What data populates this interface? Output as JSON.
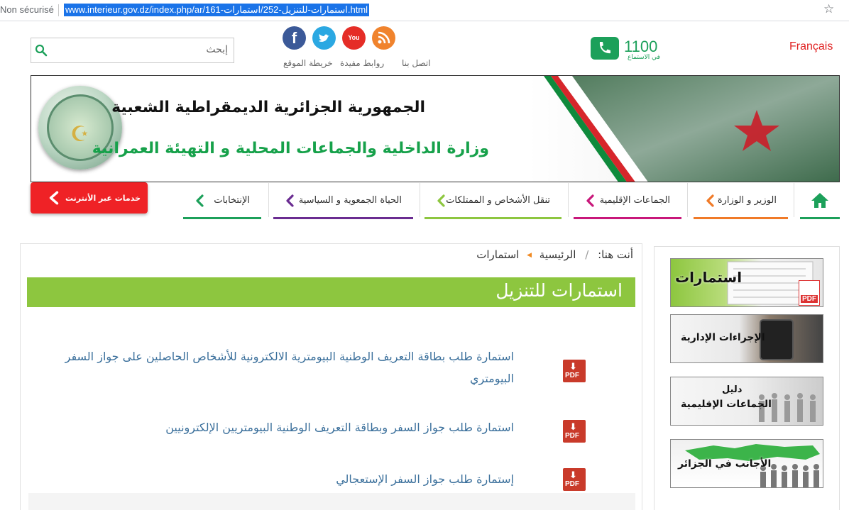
{
  "browser": {
    "insecure_label": "Non sécurisé",
    "url": "www.interieur.gov.dz/index.php/ar/161-استمارات-للتنزيل-252/استمارات.html",
    "star_icon": "star-icon"
  },
  "header": {
    "search_placeholder": "إبحث",
    "social_icons": [
      "facebook-icon",
      "twitter-icon",
      "youtube-icon",
      "rss-icon"
    ],
    "facebook_letter": "f",
    "youtube_text": "You Tube",
    "links": [
      "اتصل بنا",
      "روابط مفيدة",
      "خريطة الموقع"
    ],
    "hotline_number": "1100",
    "hotline_caption": "في الاستماع",
    "language": "Français"
  },
  "banner": {
    "title_line1": "الجمهورية الجزائرية الديمقراطية الشعبية",
    "title_line2": "وزارة الداخلية والجماعات المحلية و التهيئة العمرانية"
  },
  "nav": {
    "home_icon": "home-icon",
    "items": [
      {
        "label": "الوزير و الوزارة",
        "color": "#f07a28"
      },
      {
        "label": "الجماعات الإقليمية",
        "color": "#c8177a"
      },
      {
        "label": "تنقل الأشخاص و الممتلكات",
        "color": "#8dc63f"
      },
      {
        "label": "الحياة الجمعوية و السياسية",
        "color": "#6a2c91"
      },
      {
        "label": "الإنتخابات",
        "color": "#1ca05a"
      }
    ],
    "home_color": "#1ca05a",
    "online_services": "خدمات عبر الأنترنت",
    "online_color": "#ef2226"
  },
  "breadcrumb": {
    "prefix": "أنت هنا:",
    "home": "الرئيسية",
    "current": "استمارات"
  },
  "main": {
    "title": "استمارات للتنزيل",
    "documents": [
      {
        "title": "استمارة طلب بطاقة التعريف الوطنية البيومترية الالكترونية للأشخاص الحاصلين على جواز السفر البيومتري"
      },
      {
        "title": "استمارة طلب جواز السفر وبطاقة التعريف الوطنية البيومتريين الإلكترونيين"
      },
      {
        "title": "إستمارة طلب جواز السفر الإستعجالي"
      }
    ],
    "pdf_label": "PDF"
  },
  "sidebar": {
    "tiles": [
      {
        "label": "استمارات",
        "badge": "PDF"
      },
      {
        "label": "الإجراءات الإدارية"
      },
      {
        "label_line1": "دليل",
        "label_line2": "الجماعات الإقليمية"
      },
      {
        "label": "الأجانب في الجزائر"
      }
    ]
  }
}
